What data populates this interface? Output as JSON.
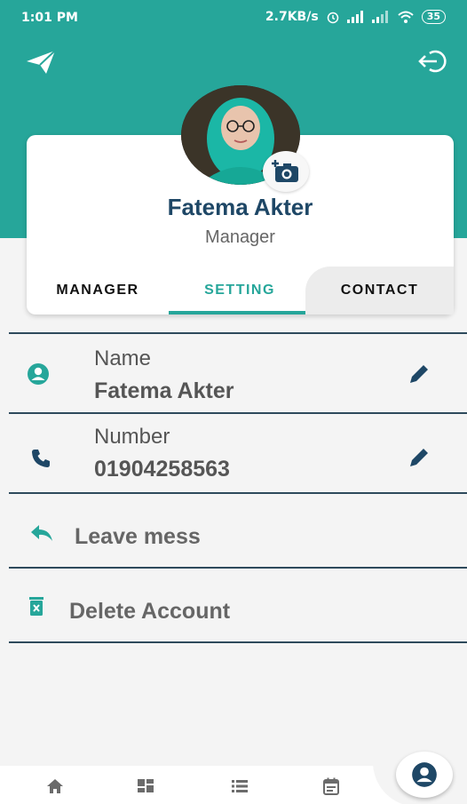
{
  "status_bar": {
    "time": "1:01 PM",
    "network_speed": "2.7KB/s",
    "battery": "35"
  },
  "profile": {
    "name": "Fatema Akter",
    "role": "Manager"
  },
  "tabs": [
    {
      "label": "MANAGER",
      "active": false
    },
    {
      "label": "SETTING",
      "active": true
    },
    {
      "label": "CONTACT",
      "active": false
    }
  ],
  "fields": {
    "name": {
      "label": "Name",
      "value": "Fatema Akter",
      "icon": "account-circle-icon"
    },
    "number": {
      "label": "Number",
      "value": "01904258563",
      "icon": "phone-icon"
    }
  },
  "actions": {
    "leave_message": {
      "label": "Leave mess",
      "icon": "reply-icon"
    },
    "delete_account": {
      "label": "Delete Account",
      "icon": "delete-box-icon"
    }
  },
  "bottom_nav": [
    "home-icon",
    "dashboard-icon",
    "list-icon",
    "calendar-icon"
  ],
  "colors": {
    "accent": "#26a69a",
    "name_text": "#1e4766",
    "divider": "#2e4a5c"
  }
}
